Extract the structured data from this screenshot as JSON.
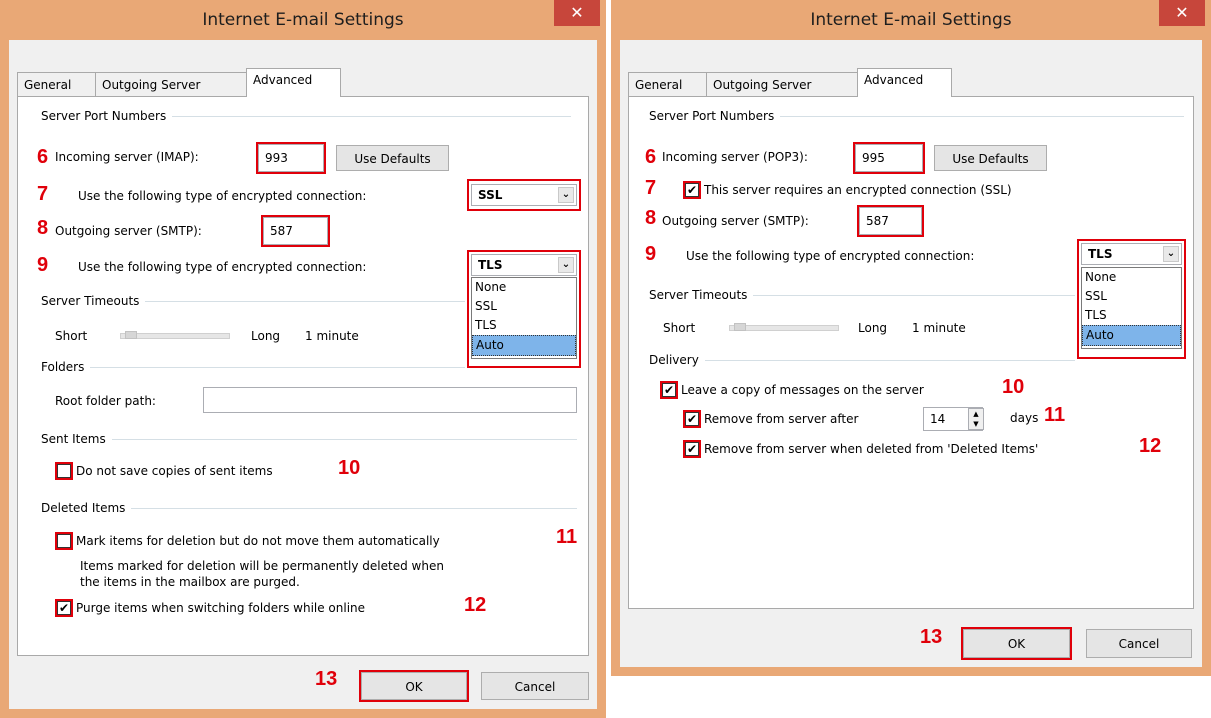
{
  "dialog_left": {
    "title": "Internet E-mail Settings",
    "close_glyph": "✕",
    "tabs": [
      "General",
      "Outgoing Server",
      "Advanced"
    ],
    "port_group": "Server Port Numbers",
    "incoming_label": "Incoming server (IMAP):",
    "incoming_value": "993",
    "use_defaults": "Use Defaults",
    "enc_label_in": "Use the following type of encrypted connection:",
    "enc_value_in": "SSL",
    "outgoing_label": "Outgoing server (SMTP):",
    "outgoing_value": "587",
    "enc_label_out": "Use the following type of encrypted connection:",
    "enc_value_out": "TLS",
    "dropdown_options": [
      "None",
      "SSL",
      "TLS",
      "Auto"
    ],
    "timeouts_group": "Server Timeouts",
    "short": "Short",
    "long": "Long",
    "timeout_value": "1 minute",
    "folders_group": "Folders",
    "root_folder_label": "Root folder path:",
    "root_folder_value": "",
    "sent_group": "Sent Items",
    "sent_checkbox": "Do not save copies of sent items",
    "deleted_group": "Deleted Items",
    "mark_checkbox": "Mark items for deletion but do not move them automatically",
    "note_line1": "Items marked for deletion will be permanently deleted when",
    "note_line2": "the items in the mailbox are purged.",
    "purge_checkbox": "Purge items when switching folders while online",
    "check_glyph": "✔",
    "ok": "OK",
    "cancel": "Cancel",
    "step_labels": [
      "6",
      "7",
      "8",
      "9",
      "10",
      "11",
      "12",
      "13"
    ]
  },
  "dialog_right": {
    "title": "Internet E-mail Settings",
    "close_glyph": "✕",
    "tabs": [
      "General",
      "Outgoing Server",
      "Advanced"
    ],
    "port_group": "Server Port Numbers",
    "incoming_label": "Incoming server (POP3):",
    "incoming_value": "995",
    "use_defaults": "Use Defaults",
    "ssl_checkbox": "This server requires an encrypted connection (SSL)",
    "outgoing_label": "Outgoing server (SMTP):",
    "outgoing_value": "587",
    "enc_label_out": "Use the following type of encrypted connection:",
    "enc_value_out": "TLS",
    "dropdown_options": [
      "None",
      "SSL",
      "TLS",
      "Auto"
    ],
    "timeouts_group": "Server Timeouts",
    "short": "Short",
    "long": "Long",
    "timeout_value": "1 minute",
    "delivery_group": "Delivery",
    "leave_copy": "Leave a copy of messages on the server",
    "remove_after": "Remove from server after",
    "days_value": "14",
    "days": "days",
    "remove_deleted": "Remove from server when deleted from 'Deleted Items'",
    "check_glyph": "✔",
    "ok": "OK",
    "cancel": "Cancel",
    "step_labels": [
      "6",
      "7",
      "8",
      "9",
      "10",
      "11",
      "12",
      "13"
    ]
  }
}
